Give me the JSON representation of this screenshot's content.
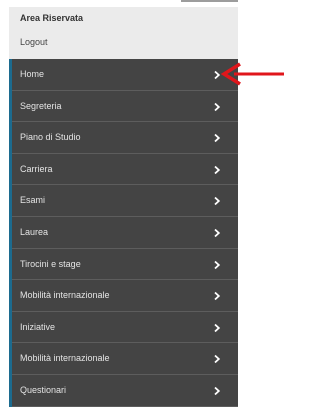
{
  "header": {
    "title": "Area Riservata",
    "logout_label": "Logout"
  },
  "menu": {
    "items": [
      {
        "label": "Home"
      },
      {
        "label": "Segreteria"
      },
      {
        "label": "Piano di Studio"
      },
      {
        "label": "Carriera"
      },
      {
        "label": "Esami"
      },
      {
        "label": "Laurea"
      },
      {
        "label": "Tirocini e stage"
      },
      {
        "label": "Mobilità internazionale"
      },
      {
        "label": "Iniziative"
      },
      {
        "label": "Mobilità internazionale"
      },
      {
        "label": "Questionari"
      }
    ]
  },
  "icons": {
    "chevron": "chevron-right-icon",
    "annotation": "red-arrow-icon"
  },
  "colors": {
    "panel_bg": "#444444",
    "header_bg": "#ebebeb",
    "accent": "#1c6b8f",
    "annotation": "#e0161b"
  }
}
